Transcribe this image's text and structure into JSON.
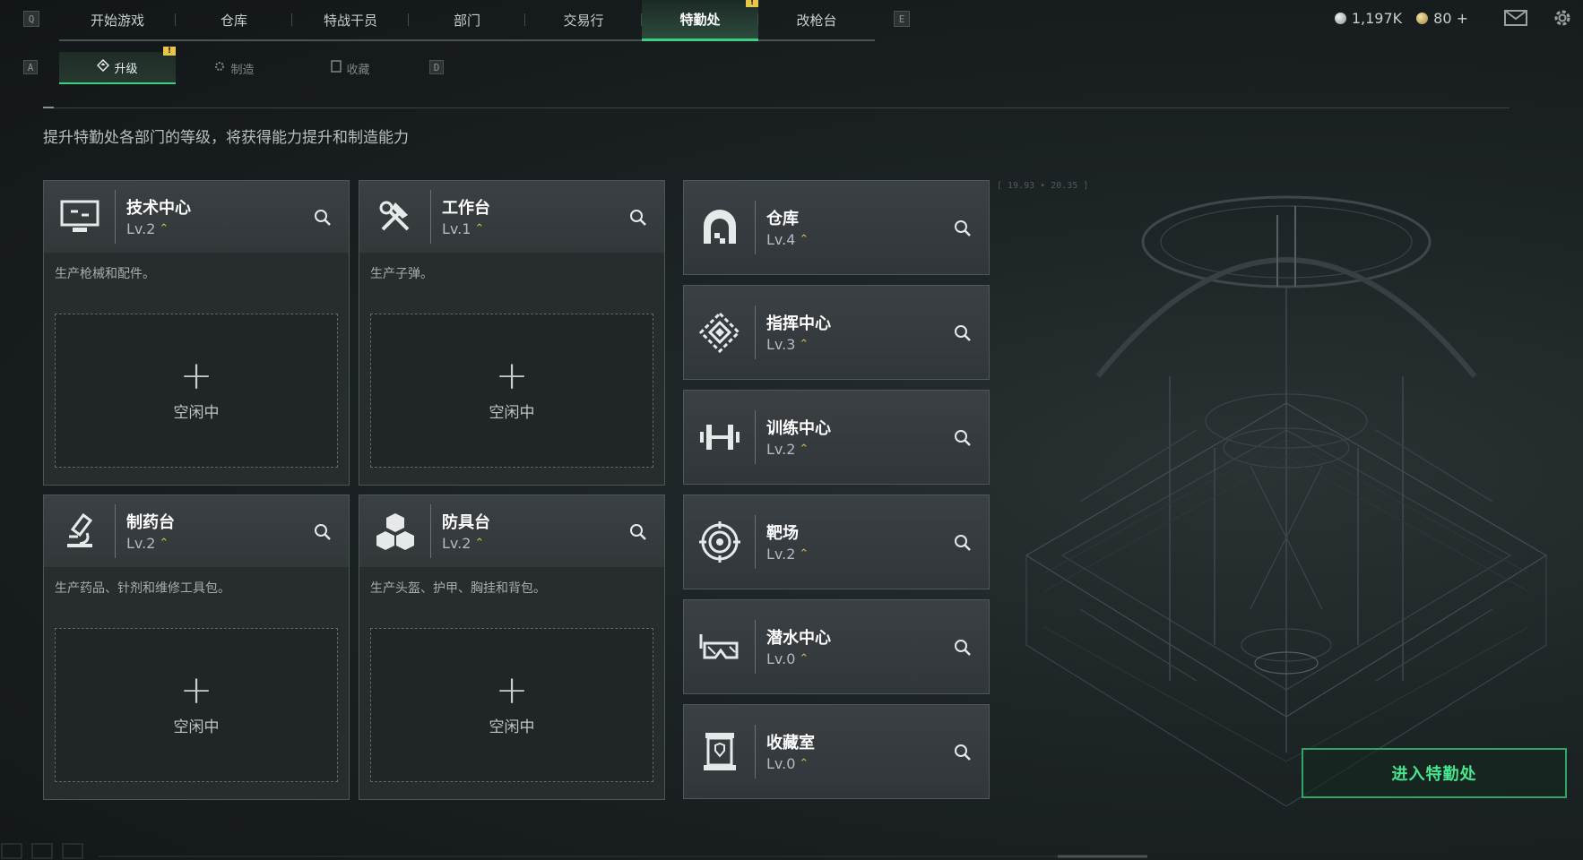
{
  "topnav": {
    "left_key": "Q",
    "right_key": "E",
    "tabs": [
      {
        "label": "开始游戏"
      },
      {
        "label": "仓库"
      },
      {
        "label": "特战干员"
      },
      {
        "label": "部门"
      },
      {
        "label": "交易行"
      },
      {
        "label": "特勤处",
        "active": true,
        "badge": "!"
      },
      {
        "label": "改枪台"
      }
    ]
  },
  "currency": {
    "silver": "1,197K",
    "gold": "80 +"
  },
  "subnav": {
    "left_key": "A",
    "right_key": "D",
    "tabs": [
      {
        "label": "升级",
        "active": true,
        "badge": "!"
      },
      {
        "label": "制造"
      },
      {
        "label": "收藏"
      }
    ]
  },
  "description": "提升特勤处各部门的等级，将获得能力提升和制造能力",
  "coords": "[ 19.93 • 20.35 ]",
  "production": [
    {
      "name": "技术中心",
      "level": "Lv.2",
      "desc": "生产枪械和配件。",
      "slot_status": "空闲中"
    },
    {
      "name": "工作台",
      "level": "Lv.1",
      "desc": "生产子弹。",
      "slot_status": "空闲中"
    },
    {
      "name": "制药台",
      "level": "Lv.2",
      "desc": "生产药品、针剂和维修工具包。",
      "slot_status": "空闲中"
    },
    {
      "name": "防具台",
      "level": "Lv.2",
      "desc": "生产头盔、护甲、胸挂和背包。",
      "slot_status": "空闲中"
    }
  ],
  "facilities": [
    {
      "name": "仓库",
      "level": "Lv.4"
    },
    {
      "name": "指挥中心",
      "level": "Lv.3"
    },
    {
      "name": "训练中心",
      "level": "Lv.2"
    },
    {
      "name": "靶场",
      "level": "Lv.2"
    },
    {
      "name": "潜水中心",
      "level": "Lv.0"
    },
    {
      "name": "收藏室",
      "level": "Lv.0"
    }
  ],
  "enter_button": "进入特勤处",
  "colors": {
    "accent": "#3ad17e",
    "badge": "#e6c54a",
    "up_arrow": "#d8b84a"
  }
}
